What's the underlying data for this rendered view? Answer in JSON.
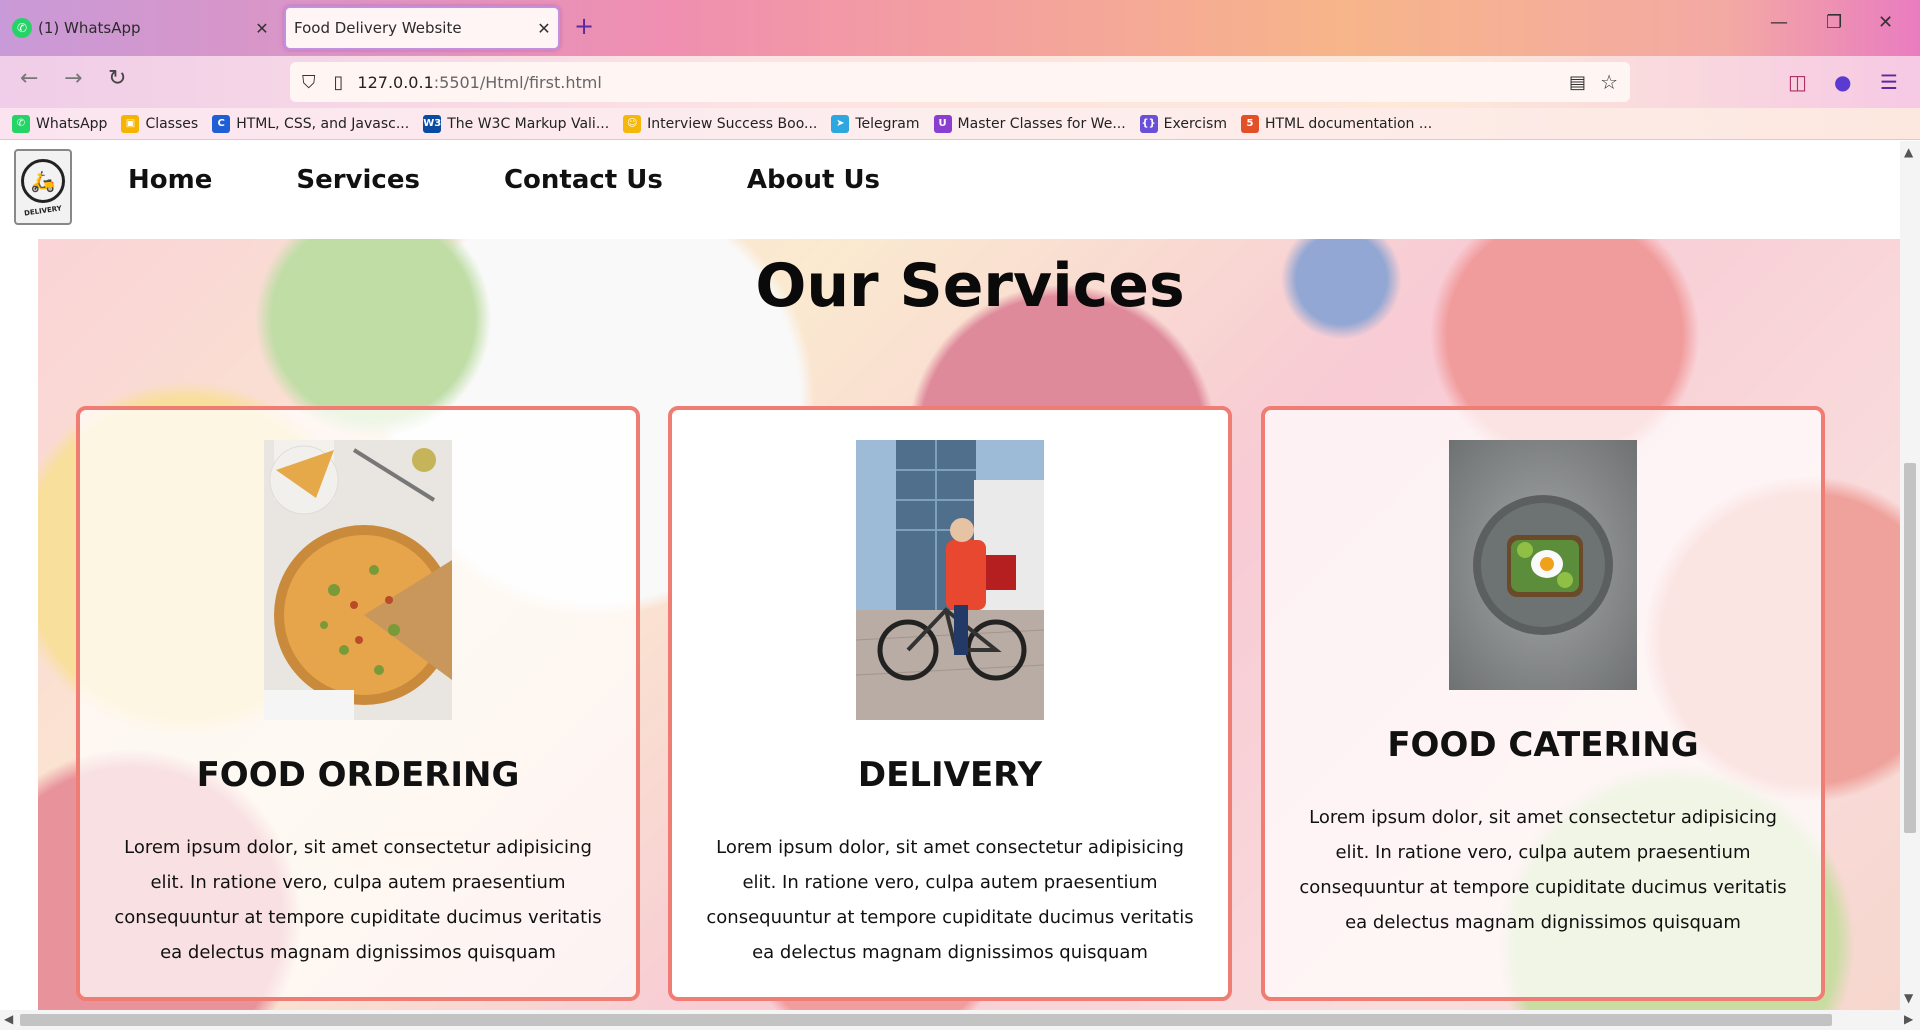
{
  "browser": {
    "tabs": [
      {
        "title": "(1) WhatsApp",
        "active": false
      },
      {
        "title": "Food Delivery Website",
        "active": true
      }
    ],
    "url_host": "127.0.0.1",
    "url_rest": ":5501/Html/first.html",
    "bookmarks": [
      {
        "label": "WhatsApp",
        "icon": "whatsapp-icon",
        "color": "#25d366",
        "glyph": "✆"
      },
      {
        "label": "Classes",
        "icon": "classroom-icon",
        "color": "#f4b400",
        "glyph": "▣"
      },
      {
        "label": "HTML, CSS, and Javasc...",
        "icon": "codecademy-icon",
        "color": "#1f5fd6",
        "glyph": "C"
      },
      {
        "label": "The W3C Markup Vali...",
        "icon": "w3c-icon",
        "color": "#0a4aa0",
        "glyph": "W3"
      },
      {
        "label": "Interview Success Boo...",
        "icon": "interview-icon",
        "color": "#f5b80a",
        "glyph": "☺"
      },
      {
        "label": "Telegram",
        "icon": "telegram-icon",
        "color": "#2ea6e0",
        "glyph": "➤"
      },
      {
        "label": "Master Classes for We...",
        "icon": "masterclass-icon",
        "color": "#8a3fd1",
        "glyph": "U"
      },
      {
        "label": "Exercism",
        "icon": "exercism-icon",
        "color": "#6a4fd8",
        "glyph": "{}"
      },
      {
        "label": "HTML documentation ...",
        "icon": "mdn-icon",
        "color": "#e34f26",
        "glyph": "5"
      }
    ]
  },
  "site": {
    "logo_text": "DELIVERY",
    "nav": [
      "Home",
      "Services",
      "Contact Us",
      "About Us"
    ],
    "section_title": "Our Services",
    "cards": [
      {
        "title": "FOOD ORDERING",
        "text": "Lorem ipsum dolor, sit amet consectetur adipisicing elit. In ratione vero, culpa autem praesentium consequuntur at tempore cupiditate ducimus veritatis ea delectus magnam dignissimos quisquam",
        "image": "pizza-photo"
      },
      {
        "title": "DELIVERY",
        "text": "Lorem ipsum dolor, sit amet consectetur adipisicing elit. In ratione vero, culpa autem praesentium consequuntur at tempore cupiditate ducimus veritatis ea delectus magnam dignissimos quisquam",
        "image": "courier-bicycle-photo"
      },
      {
        "title": "FOOD CATERING",
        "text": "Lorem ipsum dolor, sit amet consectetur adipisicing elit. In ratione vero, culpa autem praesentium consequuntur at tempore cupiditate ducimus veritatis ea delectus magnam dignissimos quisquam",
        "image": "avocado-toast-photo"
      }
    ]
  },
  "colors": {
    "card_border": "#f07d73",
    "accent": "#c58fe0"
  }
}
